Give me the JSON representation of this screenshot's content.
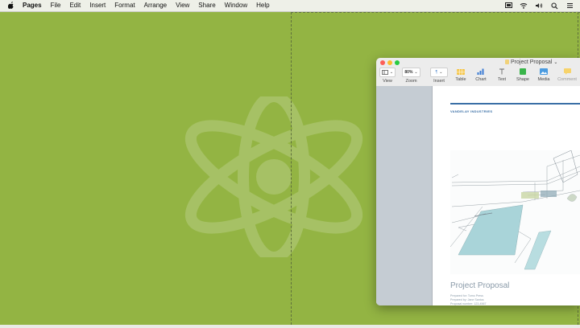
{
  "menubar": {
    "app": "Pages",
    "items": [
      "File",
      "Edit",
      "Insert",
      "Format",
      "Arrange",
      "View",
      "Share",
      "Window",
      "Help"
    ],
    "right_icons": [
      "display-icon",
      "wifi-icon",
      "volume-icon",
      "search-icon",
      "list-icon"
    ]
  },
  "window": {
    "title": "Project Proposal",
    "toolbar": {
      "view_label": "View",
      "zoom_value": "80%",
      "zoom_label": "Zoom",
      "insert_label": "Insert",
      "table_label": "Table",
      "chart_label": "Chart",
      "text_label": "Text",
      "shape_label": "Shape",
      "media_label": "Media",
      "comment_label": "Comment"
    },
    "document": {
      "company": "VANDELAY INDUSTRIES",
      "title": "Project Proposal",
      "prepared_for": "Prepared for: Tomo Press",
      "prepared_by": "Prepared by: Jane Santos",
      "proposal_number": "Proposal number: 123-4567"
    }
  },
  "colors": {
    "desktop": "#93b443",
    "accent_rule": "#3a6fa6"
  }
}
